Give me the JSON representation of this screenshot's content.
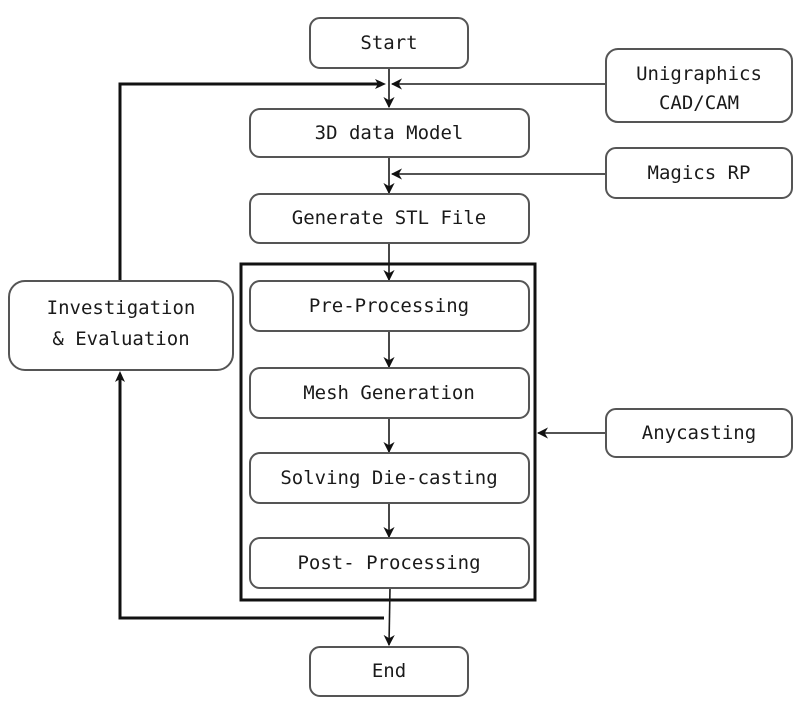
{
  "diagram": {
    "type": "flowchart",
    "nodes": {
      "start": {
        "label": "Start"
      },
      "model": {
        "label": "3D data Model"
      },
      "stl": {
        "label": "Generate STL File"
      },
      "pre": {
        "label": "Pre-Processing"
      },
      "mesh": {
        "label": "Mesh Generation"
      },
      "solve": {
        "label": "Solving Die-casting"
      },
      "post": {
        "label": "Post- Processing"
      },
      "end": {
        "label": "End"
      },
      "ug": {
        "line1": "Unigraphics",
        "line2": "CAD/CAM"
      },
      "magics": {
        "label": "Magics RP"
      },
      "anycasting": {
        "label": "Anycasting"
      },
      "invest": {
        "line1": "Investigation",
        "line2": "& Evaluation"
      }
    },
    "edges": [
      {
        "from": "start",
        "to": "model"
      },
      {
        "from": "ug",
        "to": "model"
      },
      {
        "from": "model",
        "to": "stl"
      },
      {
        "from": "magics",
        "to": "stl"
      },
      {
        "from": "stl",
        "to": "pre"
      },
      {
        "from": "pre",
        "to": "mesh"
      },
      {
        "from": "mesh",
        "to": "solve"
      },
      {
        "from": "solve",
        "to": "post"
      },
      {
        "from": "anycasting",
        "to": "simulation-group"
      },
      {
        "from": "post",
        "to": "end"
      },
      {
        "from": "post",
        "to": "invest"
      },
      {
        "from": "invest",
        "to": "model"
      }
    ]
  }
}
